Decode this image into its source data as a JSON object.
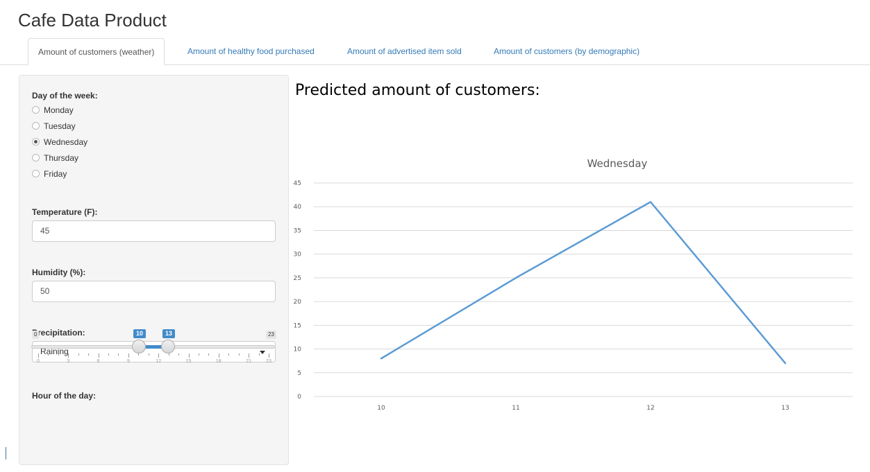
{
  "app": {
    "title": "Cafe Data Product"
  },
  "tabs": [
    {
      "label": "Amount of customers (weather)",
      "active": true
    },
    {
      "label": "Amount of healthy food purchased",
      "active": false
    },
    {
      "label": "Amount of advertised item sold",
      "active": false
    },
    {
      "label": "Amount of customers (by demographic)",
      "active": false
    }
  ],
  "sidebar": {
    "day": {
      "label": "Day of the week:",
      "options": [
        "Monday",
        "Tuesday",
        "Wednesday",
        "Thursday",
        "Friday"
      ],
      "selected": "Wednesday"
    },
    "temperature": {
      "label": "Temperature (F):",
      "value": "45"
    },
    "humidity": {
      "label": "Humidity (%):",
      "value": "50"
    },
    "precipitation": {
      "label": "Precipitation:",
      "value": "Raining"
    },
    "hour": {
      "label": "Hour of the day:",
      "min": "0",
      "max": "23",
      "from": "10",
      "to": "13",
      "grid_labels": [
        "0",
        "3",
        "6",
        "9",
        "12",
        "15",
        "18",
        "21",
        "23"
      ],
      "accent": "#428bca"
    }
  },
  "main": {
    "heading": "Predicted amount of customers:"
  },
  "chart_data": {
    "type": "line",
    "title": "Wednesday",
    "categories": [
      "10",
      "11",
      "12",
      "13"
    ],
    "series": [
      {
        "values": [
          8,
          25,
          41,
          7
        ],
        "color": "#5b9bd5"
      }
    ],
    "ylim": [
      0,
      45
    ],
    "yticks": [
      "0",
      "5",
      "10",
      "15",
      "20",
      "25",
      "30",
      "35",
      "40",
      "45"
    ],
    "grid": true,
    "legend": "none"
  }
}
